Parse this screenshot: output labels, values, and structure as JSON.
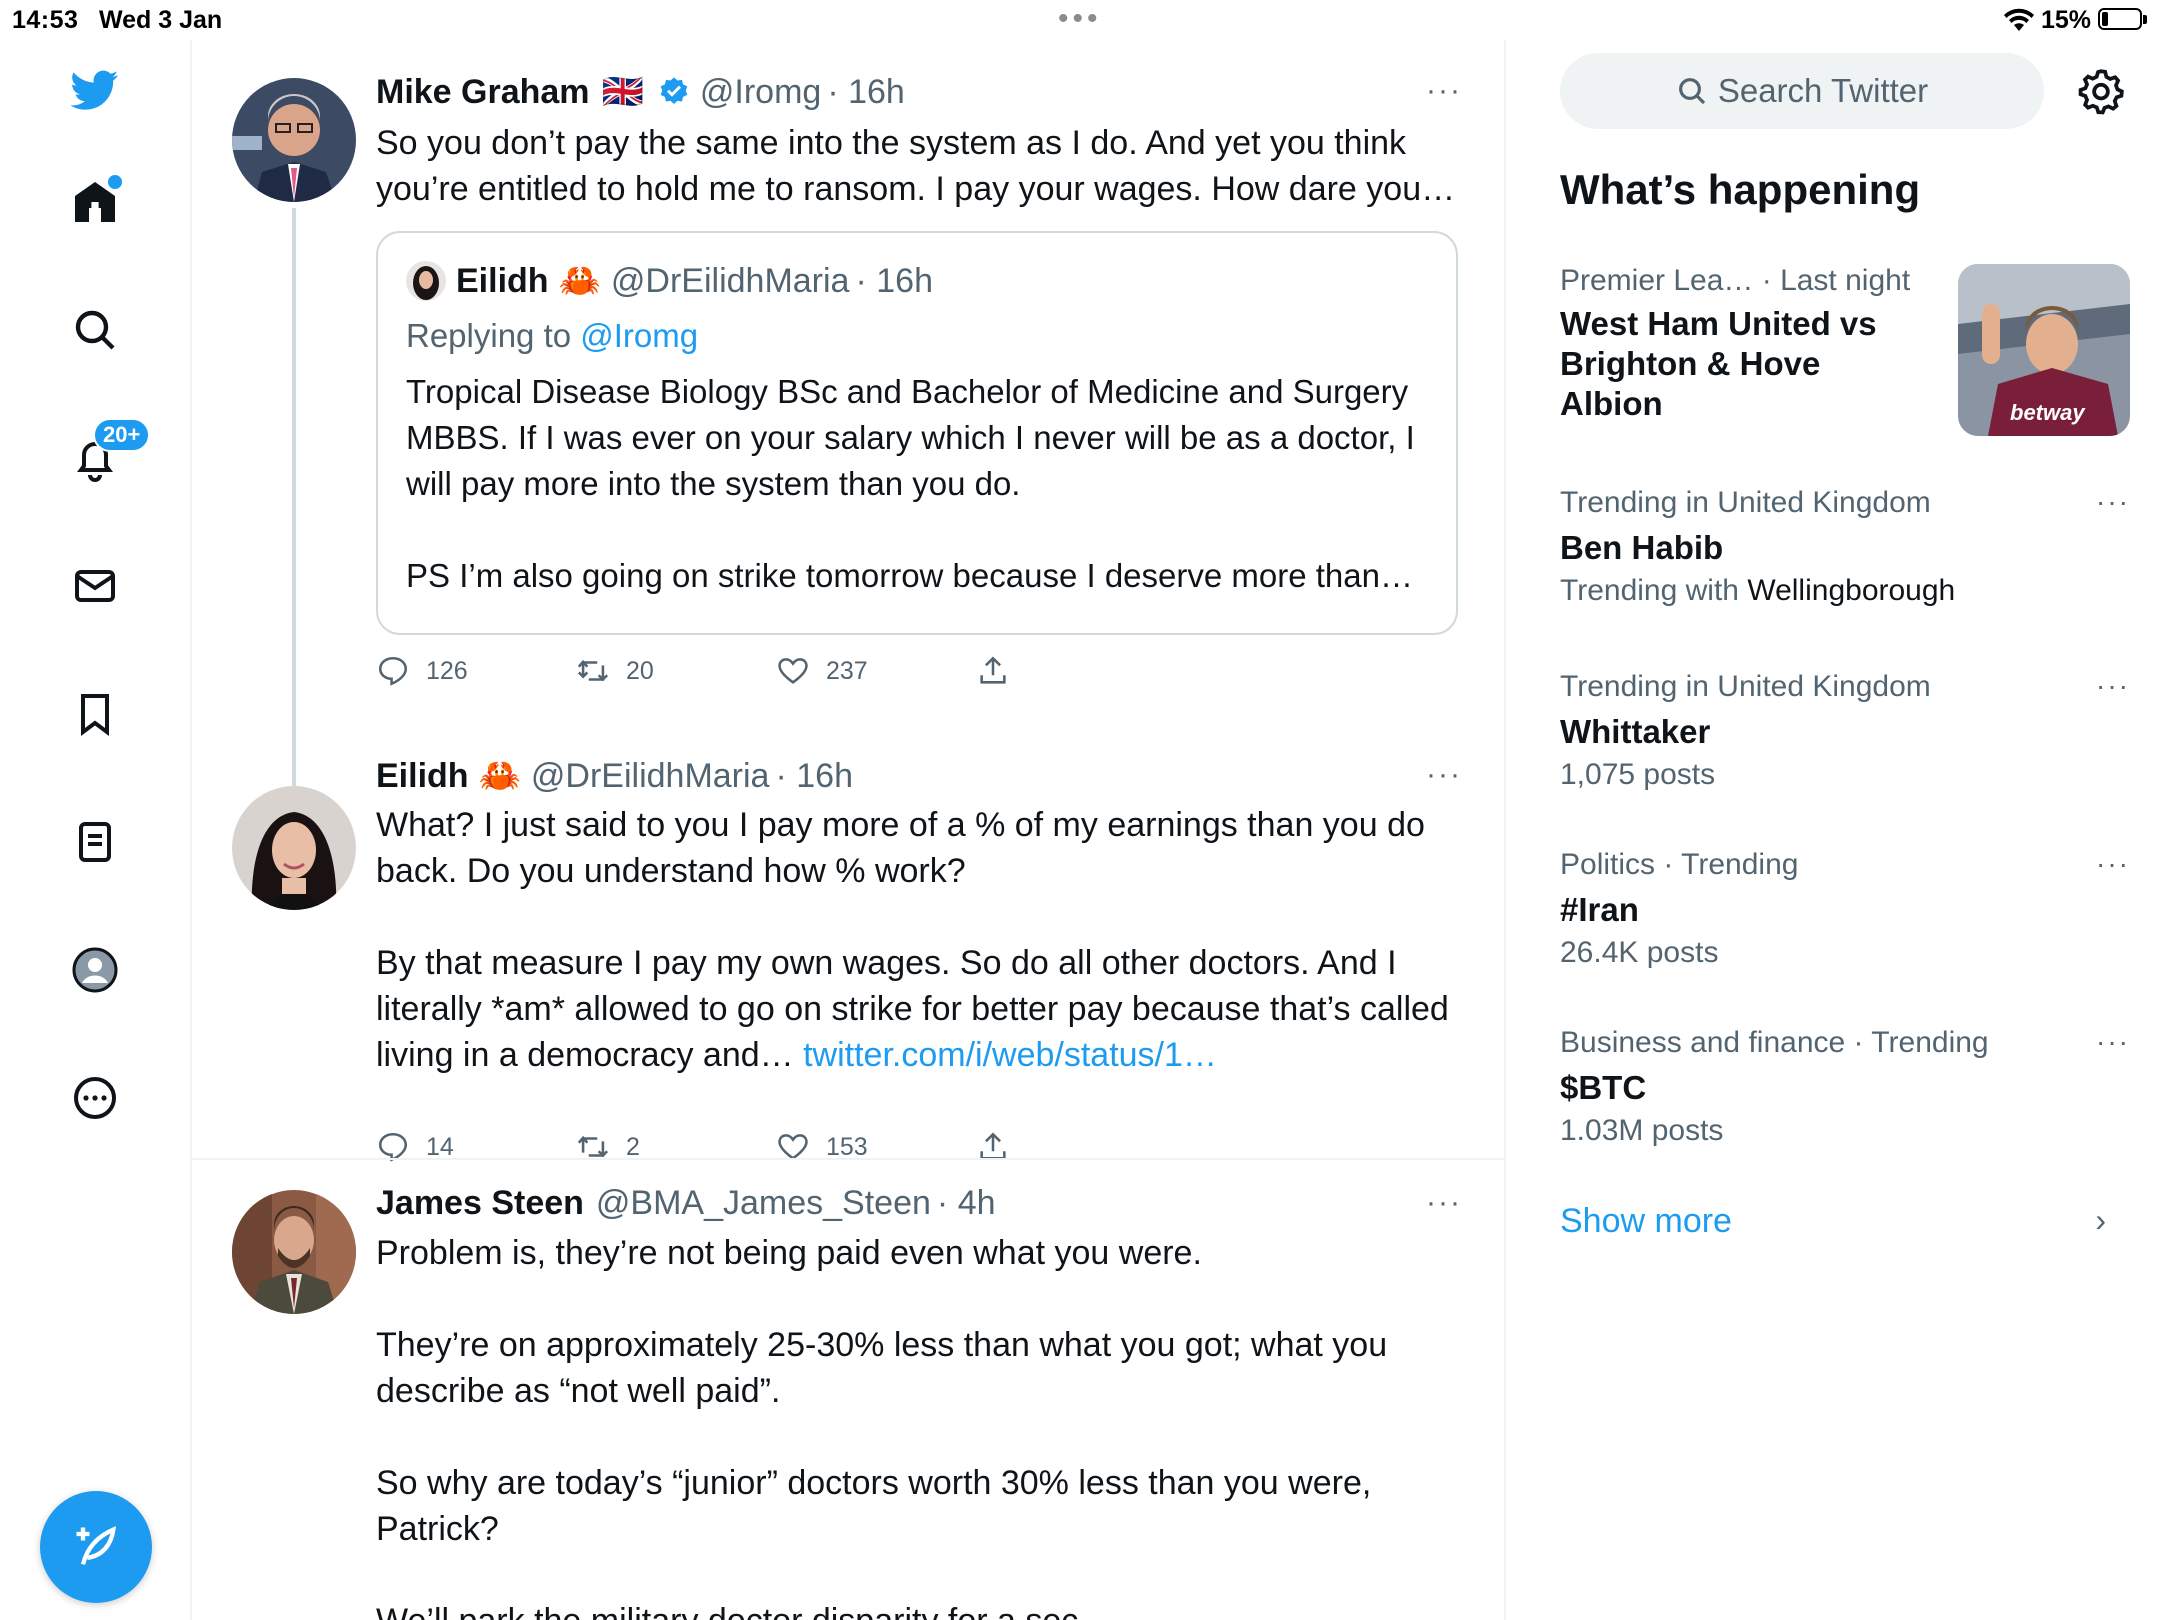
{
  "status_bar": {
    "time": "14:53",
    "date": "Wed 3 Jan",
    "battery": "15%"
  },
  "nav": {
    "notifications_badge": "20+"
  },
  "tweets": [
    {
      "name": "Mike Graham",
      "flag": "🇬🇧",
      "handle": "@Iromg",
      "time": "· 16h",
      "more": "···",
      "text": "So you don’t pay the same into the system as I do. And yet you think you’re entitled to hold me to ransom. I pay your wages. How dare you…",
      "quote": {
        "name": "Eilidh",
        "emoji": "🦀",
        "handle": "@DrEilidhMaria",
        "time": "· 16h",
        "reply_prefix": "Replying to ",
        "reply_to": "@Iromg",
        "text": "Tropical Disease Biology BSc and Bachelor of Medicine and Surgery MBBS. If I was ever on your salary which I never will be as a doctor, I will pay more into the system than you do.\n\nPS I’m also going on strike tomorrow because I deserve more than…"
      },
      "replies": "126",
      "retweets": "20",
      "likes": "237"
    },
    {
      "name": "Eilidh",
      "emoji": "🦀",
      "handle": "@DrEilidhMaria",
      "time": "· 16h",
      "more": "···",
      "text": "What? I just said to you I pay more of a % of my earnings than you do back. Do you understand how % work?\n\nBy that measure I pay my own wages. So do all other doctors. And I literally *am* allowed to go on strike for better pay because that’s called living in a democracy and… ",
      "link": "twitter.com/i/web/status/1…",
      "replies": "14",
      "retweets": "2",
      "likes": "153"
    },
    {
      "name": "James Steen",
      "handle": "@BMA_James_Steen",
      "time": "· 4h",
      "more": "···",
      "text": "Problem is, they’re not being paid even what you were.\n\nThey’re on approximately 25-30% less than what you got; what you describe as “not well paid”.\n\nSo why are today’s “junior” doctors worth 30% less than you were, Patrick?\n\nWe’ll park the military doctor disparity for a sec."
    }
  ],
  "sidebar": {
    "search_placeholder": "Search Twitter",
    "whats_happening": "What’s happening",
    "trends": [
      {
        "meta": "Premier Lea…",
        "meta2": " · Last night",
        "title": "West Ham United vs Brighton & Hove Albion"
      },
      {
        "meta": "Trending in United Kingdom",
        "title": "Ben Habib",
        "sub_prefix": "Trending with ",
        "sub": "Wellingborough"
      },
      {
        "meta": "Trending in United Kingdom",
        "title": "Whittaker",
        "sub": "1,075 posts"
      },
      {
        "meta": "Politics · Trending",
        "title": "#Iran",
        "sub": "26.4K posts"
      },
      {
        "meta": "Business and finance · Trending",
        "title": "$BTC",
        "sub": "1.03M posts"
      }
    ],
    "show_more": "Show more",
    "img_text": "betway"
  },
  "colors": {
    "accent": "#1d9bf0",
    "text": "#0f1419",
    "muted": "#536471",
    "border": "#cfd9de"
  }
}
